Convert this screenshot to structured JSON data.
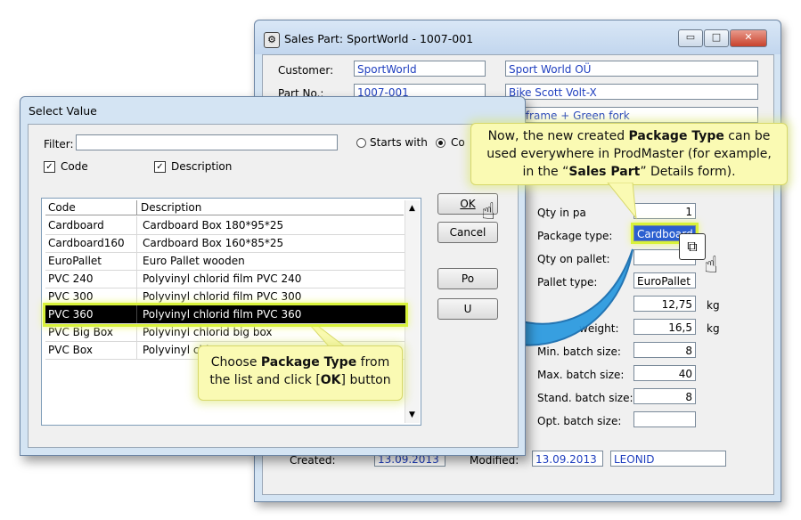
{
  "sales_window": {
    "title": "Sales Part: SportWorld - 1007-001",
    "controls": {
      "minimize": "▭",
      "maximize": "□",
      "close": "✕"
    },
    "customer_label": "Customer:",
    "customer_code": "SportWorld",
    "customer_name": "Sport World OÜ",
    "part_label": "Part No.:",
    "part_code": "1007-001",
    "part_name": "Bike Scott Volt-X",
    "part_desc": "en frame + Green fork",
    "fields": {
      "qty_in_pack_label": "Qty in pa",
      "qty_in_pack": "1",
      "package_type_label": "Package type:",
      "package_type": "Cardboard",
      "qty_on_pallet_label": "Qty on pallet:",
      "pallet_type_label": "Pallet type:",
      "pallet_type": "EuroPallet",
      "net_weight": "12,75",
      "gross_weight_label": "weight:",
      "gross_weight": "16,5",
      "unit_kg": "kg",
      "min_batch_label": "Min. batch size:",
      "min_batch": "8",
      "max_batch_label": "Max. batch size:",
      "max_batch": "40",
      "stand_batch_label": "Stand. batch size:",
      "stand_batch": "8",
      "opt_batch_label": "Opt. batch size:",
      "opt_batch": ""
    },
    "footer": {
      "created_label": "Created:",
      "created": "13.09.2013",
      "modified_label": "Modified:",
      "modified": "13.09.2013",
      "user": "LEONID"
    }
  },
  "select_dialog": {
    "title": "Select Value",
    "filter_label": "Filter:",
    "filter_value": "",
    "starts_with_label": "Starts with",
    "contains_label": "Co",
    "code_check_label": "Code",
    "description_check_label": "Description",
    "columns": [
      "Code",
      "Description"
    ],
    "rows": [
      {
        "code": "Cardboard",
        "description": "Cardboard Box 180*95*25"
      },
      {
        "code": "Cardboard160",
        "description": "Cardboard Box 160*85*25"
      },
      {
        "code": "EuroPallet",
        "description": "Euro Pallet wooden"
      },
      {
        "code": "PVC 240",
        "description": "Polyvinyl chlorid film PVC 240"
      },
      {
        "code": "PVC 300",
        "description": "Polyvinyl chlorid film PVC 300"
      },
      {
        "code": "PVC 360",
        "description": "Polyvinyl chlorid film PVC 360"
      },
      {
        "code": "PVC Big Box",
        "description": "Polyvinyl chlorid big box"
      },
      {
        "code": "PVC Box",
        "description": "Polyvinyl chl"
      }
    ],
    "ok_label": "OK",
    "cancel_label": "Cancel",
    "btn3_label": "Po",
    "btn4_label": "U"
  },
  "callouts": {
    "top": {
      "line1_pre": "Now, the new created ",
      "line1_bold": "Package Type",
      "line1_post": " can be",
      "line2": "used everywhere in ProdMaster (for example,",
      "line3_pre": "in the “",
      "line3_bold": "Sales Part",
      "line3_post": "” Details form)."
    },
    "bottom": {
      "line1_pre": "Choose ",
      "line1_bold": "Package Type",
      "line1_post": " from",
      "line2_pre": "the list and click [",
      "line2_bold": "OK",
      "line2_post": "] button"
    }
  },
  "colors": {
    "arrow": "#2e9be0",
    "callout_bg": "#fafab3",
    "highlight": "#d8f23a"
  }
}
